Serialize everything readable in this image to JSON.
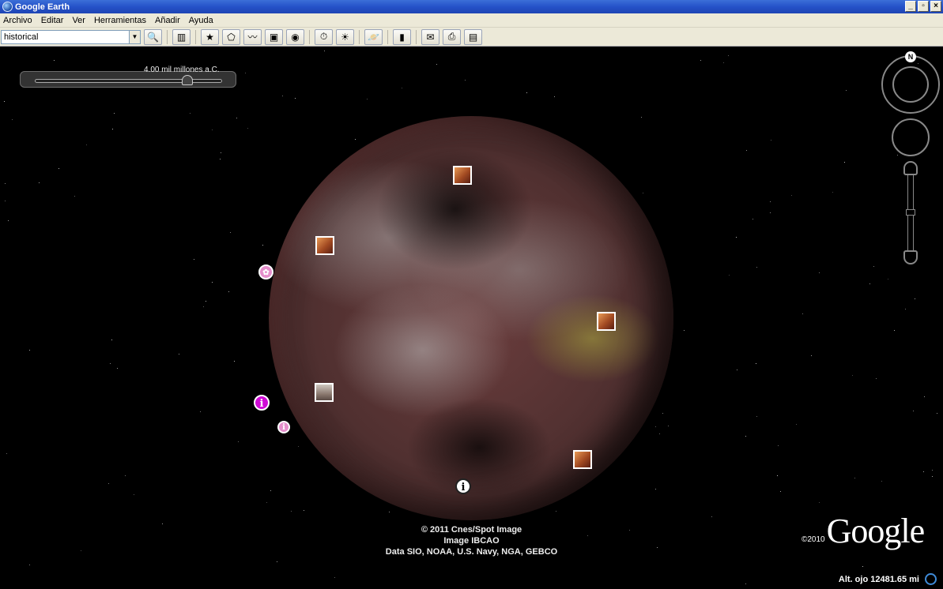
{
  "window": {
    "title": "Google Earth"
  },
  "window_controls": {
    "minimize": "_",
    "maximize": "▫",
    "close": "×"
  },
  "menu": [
    "Archivo",
    "Editar",
    "Ver",
    "Herramientas",
    "Añadir",
    "Ayuda"
  ],
  "search": {
    "value": "historical"
  },
  "toolbar": {
    "icons": [
      "search-icon",
      "sidebar-icon",
      "placemark-icon",
      "polygon-icon",
      "path-icon",
      "image-overlay-icon",
      "record-tour-icon",
      "historical-imagery-icon",
      "sunlight-icon",
      "sky-icon",
      "ruler-icon",
      "email-icon",
      "print-icon",
      "save-image-icon"
    ]
  },
  "time_slider": {
    "label": "4.00 mil millones a.C."
  },
  "compass": {
    "north_label": "N"
  },
  "credits": {
    "line1": "© 2011 Cnes/Spot Image",
    "line2": "Image IBCAO",
    "line3": "Data SIO, NOAA, U.S. Navy, NGA, GEBCO"
  },
  "branding": {
    "year": "©2010",
    "logo": "Google"
  },
  "status": {
    "altitude": "Alt. ojo 12481.65 mi"
  },
  "colors": {
    "titlebar": "#2552c8",
    "chrome": "#ece9d8",
    "pin_magenta": "#d00ad6",
    "pin_pink": "#e58ecb"
  }
}
